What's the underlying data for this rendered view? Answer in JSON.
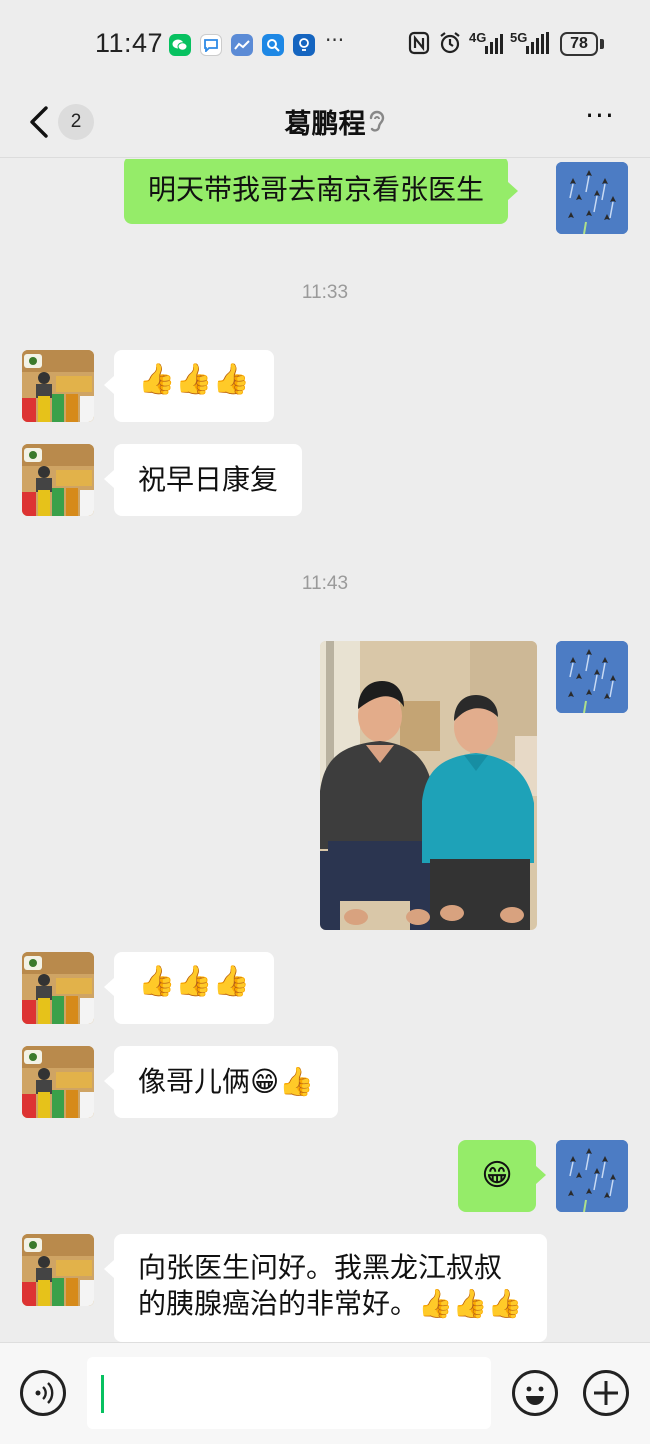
{
  "status_bar": {
    "time": "11:47",
    "more_notifications": "···",
    "network_4g": "4G",
    "network_5g": "5G",
    "battery": "78"
  },
  "nav": {
    "unread_count": "2",
    "title": "葛鹏程",
    "more": "···"
  },
  "messages": [
    {
      "sender": "self",
      "type": "text",
      "text": "明天带我哥去南京看张医生"
    },
    {
      "type": "time",
      "text": "11:33"
    },
    {
      "sender": "other",
      "type": "emoji",
      "text": "👍👍👍"
    },
    {
      "sender": "other",
      "type": "text",
      "text": "祝早日康复"
    },
    {
      "type": "time",
      "text": "11:43"
    },
    {
      "sender": "self",
      "type": "image"
    },
    {
      "sender": "other",
      "type": "emoji",
      "text": "👍👍👍"
    },
    {
      "sender": "other",
      "type": "text",
      "text": "像哥儿俩😁👍"
    },
    {
      "sender": "self",
      "type": "emoji",
      "text": "😁"
    },
    {
      "sender": "other",
      "type": "text",
      "lines": [
        "向张医生问好。我黑龙江叔叔",
        "的胰腺癌治的非常好。👍👍👍"
      ]
    }
  ],
  "input": {
    "value": ""
  },
  "colors": {
    "background": "#ededed",
    "bubble_out": "#95ec69",
    "bubble_in": "#ffffff",
    "cursor": "#07c160"
  },
  "icons": {
    "wechat": "wechat-icon",
    "back": "chevron-left-icon",
    "ear": "ear-icon",
    "voice": "voice-icon",
    "emoji": "smiley-icon",
    "plus": "plus-icon"
  }
}
